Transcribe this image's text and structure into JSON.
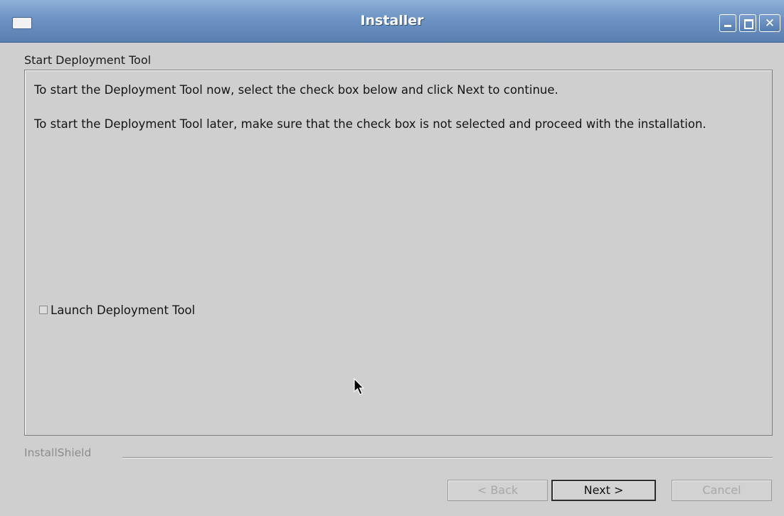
{
  "window": {
    "title": "Installer"
  },
  "page": {
    "section_title": "Start Deployment Tool",
    "paragraph1": "To start the Deployment Tool now, select the check box below and click Next to continue.",
    "paragraph2": "To start the Deployment Tool later, make sure that the check box is not selected and proceed with the installation.",
    "checkbox": {
      "label": "Launch Deployment Tool",
      "checked": false
    }
  },
  "footer": {
    "brand": "InstallShield",
    "back_label": "< Back",
    "next_label": "Next >",
    "cancel_label": "Cancel"
  },
  "colors": {
    "titlebar": "#6d93c4",
    "window_bg": "#cfcfcf",
    "disabled_text": "#a8a8a8"
  }
}
